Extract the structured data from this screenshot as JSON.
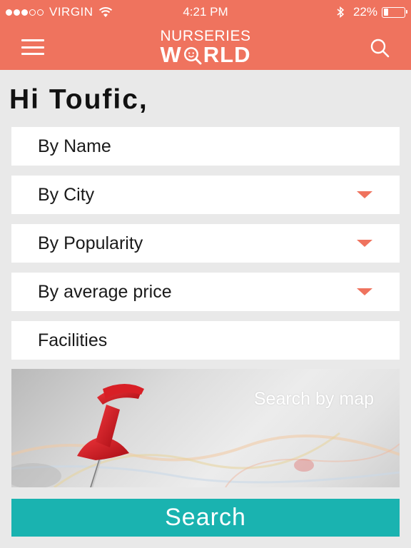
{
  "status_bar": {
    "carrier": "VIRGIN",
    "signal_bars_filled": 3,
    "signal_bars_total": 5,
    "time": "4:21 PM",
    "battery_text": "22%",
    "battery_level": 0.22
  },
  "header": {
    "logo_line1": "NURSERIES",
    "logo_line2_a": "W",
    "logo_line2_b": "RLD",
    "background_color": "#ef735e"
  },
  "greeting": "Hi Toufic,",
  "filters": [
    {
      "label": "By Name",
      "has_dropdown": false
    },
    {
      "label": "By City",
      "has_dropdown": true
    },
    {
      "label": "By Popularity",
      "has_dropdown": true
    },
    {
      "label": "By average price",
      "has_dropdown": true
    },
    {
      "label": "Facilities",
      "has_dropdown": false
    }
  ],
  "map_card": {
    "label": "Search by map",
    "icon": "push-pin-icon"
  },
  "search_button": {
    "label": "Search",
    "color": "#1ab3b0"
  },
  "icons": {
    "menu": "hamburger-menu-icon",
    "search": "magnifier-icon",
    "dropdown": "caret-down-icon"
  }
}
